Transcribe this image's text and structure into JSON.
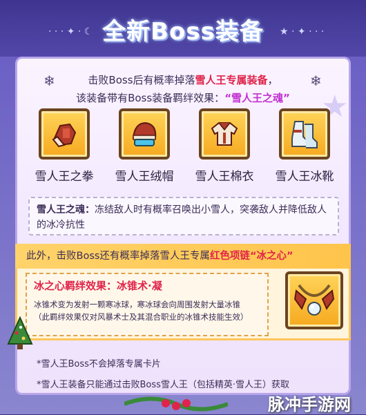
{
  "header": {
    "title": "全新Boss装备"
  },
  "intro": {
    "line1_prefix": "击败Boss后有概率掉落",
    "line1_highlight": "雪人王专属装备",
    "line1_suffix": "，",
    "line2_prefix": "该装备带有Boss装备羁绊效果：",
    "line2_highlight": "“雪人王之魂”"
  },
  "items": [
    {
      "name": "雪人王之拳",
      "icon": "glove-icon"
    },
    {
      "name": "雪人王绒帽",
      "icon": "hat-icon"
    },
    {
      "name": "雪人王棉衣",
      "icon": "coat-icon"
    },
    {
      "name": "雪人王冰靴",
      "icon": "boots-icon"
    }
  ],
  "soul_desc": {
    "label": "雪人王之魂：",
    "text": "冻结敌人时有概率召唤出小雪人，突袭敌人并降低敌人的冰冷抗性"
  },
  "extra": {
    "prefix": "此外，击败Boss还有概率掉落雪人王专属",
    "highlight": "红色项链",
    "name": "“冰之心”"
  },
  "heart_effect": {
    "title": "冰之心羁绊效果：冰锥术·凝",
    "line1": "冰锥术变为发射一颗寒冰球，寒冰球会向周围发射大量冰锥",
    "line2": "（此羁绊效果仅对风暴术士及其混合职业的冰锥术技能生效）"
  },
  "notes": [
    "*雪人王Boss不会掉落专属卡片",
    "*雪人王装备只能通过击败Boss雪人王（包括精英·雪人王）获取"
  ],
  "watermark": "脉冲手游网",
  "colors": {
    "accent_red": "#e0234a",
    "accent_purple": "#c12fd0",
    "header_bg": "#4a3fa0",
    "gold_band": "#ffc44b"
  }
}
